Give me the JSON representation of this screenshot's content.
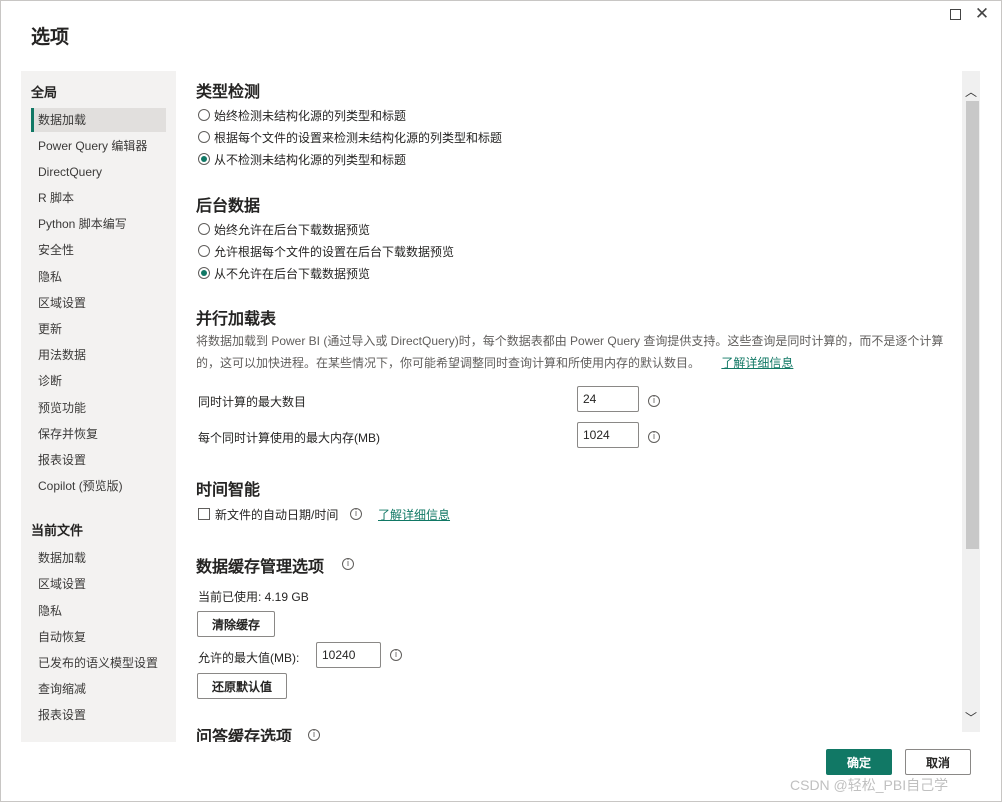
{
  "dialog": {
    "title": "选项"
  },
  "window": {
    "maximize_icon": "maximize-icon",
    "close_icon": "close-icon",
    "close_glyph": "✕"
  },
  "sidebar": {
    "global_heading": "全局",
    "global_items": [
      {
        "label": "数据加载",
        "active": true
      },
      {
        "label": "Power Query 编辑器"
      },
      {
        "label": "DirectQuery"
      },
      {
        "label": "R 脚本"
      },
      {
        "label": "Python 脚本编写"
      },
      {
        "label": "安全性"
      },
      {
        "label": "隐私"
      },
      {
        "label": "区域设置"
      },
      {
        "label": "更新"
      },
      {
        "label": "用法数据"
      },
      {
        "label": "诊断"
      },
      {
        "label": "预览功能"
      },
      {
        "label": "保存并恢复"
      },
      {
        "label": "报表设置"
      },
      {
        "label": "Copilot (预览版)"
      }
    ],
    "file_heading": "当前文件",
    "file_items": [
      {
        "label": "数据加载"
      },
      {
        "label": "区域设置"
      },
      {
        "label": "隐私"
      },
      {
        "label": "自动恢复"
      },
      {
        "label": "已发布的语义模型设置"
      },
      {
        "label": "查询缩减"
      },
      {
        "label": "报表设置"
      }
    ]
  },
  "type_detection": {
    "title": "类型检测",
    "options": [
      "始终检测未结构化源的列类型和标题",
      "根据每个文件的设置来检测未结构化源的列类型和标题",
      "从不检测未结构化源的列类型和标题"
    ],
    "selected_index": 2
  },
  "background_data": {
    "title": "后台数据",
    "options": [
      "始终允许在后台下载数据预览",
      "允许根据每个文件的设置在后台下载数据预览",
      "从不允许在后台下载数据预览"
    ],
    "selected_index": 2
  },
  "parallel_loading": {
    "title": "并行加载表",
    "description_line1": "将数据加载到 Power BI (通过导入或 DirectQuery)时，每个数据表都由 Power Query 查询提供支持。这些查询是同时计算的，而不是逐个计算",
    "description_line2": "的，这可以加快进程。在某些情况下，你可能希望调整同时查询计算和所使用内存的默认数目。",
    "learn_more": "了解详细信息",
    "max_concurrent_label": "同时计算的最大数目",
    "max_concurrent_value": "24",
    "max_memory_label": "每个同时计算使用的最大内存(MB)",
    "max_memory_value": "1024"
  },
  "time_intelligence": {
    "title": "时间智能",
    "auto_date_label": "新文件的自动日期/时间",
    "auto_date_checked": false,
    "learn_more": "了解详细信息"
  },
  "data_cache": {
    "title": "数据缓存管理选项",
    "current_used": "当前已使用: 4.19 GB",
    "clear_button": "清除缓存",
    "max_allowed_label": "允许的最大值(MB):",
    "max_allowed_value": "10240",
    "restore_button": "还原默认值"
  },
  "qa_cache": {
    "title": "问答缓存选项"
  },
  "footer": {
    "ok": "确定",
    "cancel": "取消"
  },
  "watermark": "CSDN @轻松_PBI自己学",
  "colors": {
    "accent": "#117865",
    "sidebar_bg": "#f3f2f1",
    "active_bg": "#e1dfdd"
  }
}
